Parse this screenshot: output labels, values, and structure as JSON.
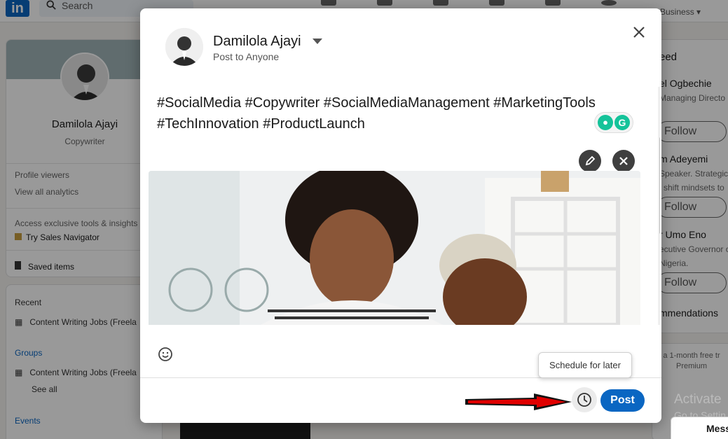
{
  "app": {
    "logo_text": "in",
    "search_placeholder": "Search",
    "business_label": "Business"
  },
  "left_profile": {
    "name": "Damilola Ajayi",
    "headline": "Copywriter",
    "profile_viewers": "Profile viewers",
    "view_analytics": "View all analytics",
    "access_text": "Access exclusive tools & insights",
    "sales_navigator": "Try Sales Navigator",
    "saved_items": "Saved items"
  },
  "left_nav": {
    "recent_label": "Recent",
    "recent_item": "Content Writing Jobs (Freela",
    "groups_label": "Groups",
    "groups_item": "Content Writing Jobs (Freela",
    "see_all": "See all",
    "events_label": "Events"
  },
  "right_panel": {
    "title": "eed",
    "people": [
      {
        "name": "el Ogbechie",
        "sub1": "Managing Directo",
        "sub2": ""
      },
      {
        "name": "m Adeyemi",
        "sub1": "Speaker. Strategic",
        "sub2": "l shift mindsets to"
      },
      {
        "name": "r Umo Eno",
        "sub1": "ecutive Governor o",
        "sub2": "Nigeria."
      }
    ],
    "follow_label": "Follow",
    "recommendations": "mmendations",
    "premium_line1": "a 1-month free tr",
    "premium_line2": "Premium",
    "activate": "Activate",
    "goto": "Go to Settin",
    "messaging": "Mess"
  },
  "modal": {
    "author_name": "Damilola Ajayi",
    "audience": "Post to Anyone",
    "post_text_line1": "#SocialMedia #Copywriter #SocialMediaManagement #MarketingTools",
    "post_text_line2": "#TechInnovation #ProductLaunch",
    "post_button": "Post",
    "schedule_tooltip": "Schedule for later",
    "colors": {
      "primary": "#0a66c2",
      "dark_button": "#3f3f3f",
      "annotation_arrow": "#e00000"
    }
  },
  "icons": [
    "search-icon",
    "close-icon",
    "pencil-icon",
    "remove-image-icon",
    "emoji-icon",
    "clock-icon",
    "dropdown-caret-icon",
    "grammarly-icon"
  ]
}
